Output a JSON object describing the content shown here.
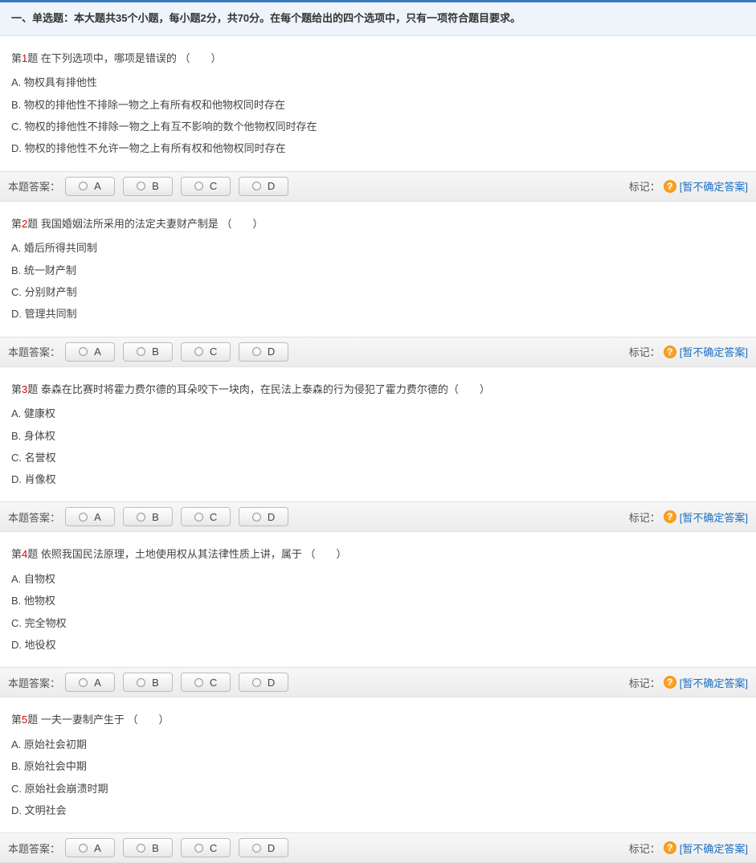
{
  "section_header": "一、单选题：本大题共35个小题，每小题2分，共70分。在每个题给出的四个选项中，只有一项符合题目要求。",
  "answer_label": "本题答案：",
  "mark_label": "标记：",
  "help_symbol": "?",
  "unsure_text": "[暂不确定答案]",
  "choices": [
    "A",
    "B",
    "C",
    "D"
  ],
  "questions": [
    {
      "prefix": "第",
      "num": "1",
      "suffix": "题",
      "text": "  在下列选项中，哪项是错误的 （　　）",
      "options": [
        "A. 物权具有排他性",
        "B. 物权的排他性不排除一物之上有所有权和他物权同时存在",
        "C. 物权的排他性不排除一物之上有互不影响的数个他物权同时存在",
        "D. 物权的排他性不允许一物之上有所有权和他物权同时存在"
      ]
    },
    {
      "prefix": "第",
      "num": "2",
      "suffix": "题",
      "text": "  我国婚姻法所采用的法定夫妻财产制是 （　　）",
      "options": [
        "A. 婚后所得共同制",
        "B. 统一财产制",
        "C. 分别财产制",
        "D. 管理共同制"
      ]
    },
    {
      "prefix": "第",
      "num": "3",
      "suffix": "题",
      "text": "  泰森在比赛时将霍力费尔德的耳朵咬下一块肉，在民法上泰森的行为侵犯了霍力费尔德的（　　）",
      "options": [
        "A. 健康权",
        "B. 身体权",
        "C. 名誉权",
        "D. 肖像权"
      ]
    },
    {
      "prefix": "第",
      "num": "4",
      "suffix": "题",
      "text": "  依照我国民法原理，土地使用权从其法律性质上讲，属于 （　　）",
      "options": [
        "A. 自物权",
        "B. 他物权",
        "C. 完全物权",
        "D. 地役权"
      ]
    },
    {
      "prefix": "第",
      "num": "5",
      "suffix": "题",
      "text": "  一夫一妻制产生于 （　　）",
      "options": [
        "A. 原始社会初期",
        "B. 原始社会中期",
        "C. 原始社会崩溃时期",
        "D. 文明社会"
      ]
    }
  ]
}
